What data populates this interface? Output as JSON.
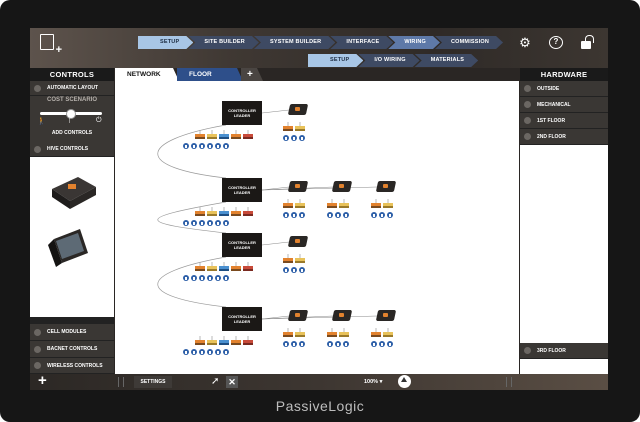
{
  "toolbar": {
    "workflow_primary": [
      "SETUP",
      "SITE BUILDER",
      "SYSTEM BUILDER",
      "INTERFACE",
      "WIRING",
      "COMMISSION"
    ],
    "workflow_secondary": [
      "SETUP",
      "I/O WIRING",
      "MATERIALS"
    ],
    "icons": [
      "new-document-icon",
      "gear-icon",
      "help-icon",
      "lock-icon"
    ]
  },
  "left_panel": {
    "title": "CONTROLS",
    "automatic_layout": "AUTOMATIC LAYOUT",
    "cost_scenario": "COST SCENARIO",
    "slider_value": 0.5,
    "add_controls": "ADD CONTROLS",
    "hive_controls": "HIVE CONTROLS",
    "bottom_items": [
      "CELL MODULES",
      "BACNET CONTROLS",
      "WIRELESS CONTROLS"
    ]
  },
  "tabs": {
    "network": "NETWORK",
    "floor": "FLOOR",
    "add": "+"
  },
  "right_panel": {
    "title": "HARDWARE",
    "items": [
      "OUTSIDE",
      "MECHANICAL",
      "1ST FLOOR",
      "2ND FLOOR"
    ],
    "bottom_item": "3RD FLOOR"
  },
  "diagram": {
    "controller_label": "CONTROLLER LEADER",
    "groups": [
      {
        "extra_devices": 1
      },
      {
        "extra_devices": 3
      },
      {
        "extra_devices": 1
      },
      {
        "extra_devices": 3
      }
    ]
  },
  "bottom_bar": {
    "settings": "SETTINGS",
    "zoom": "100%  ▾"
  },
  "brand": "PassiveLogic",
  "colors": {
    "accent": "#2e4f8a",
    "active_step": "#a8c6e6",
    "device_orange": "#e2822e"
  }
}
